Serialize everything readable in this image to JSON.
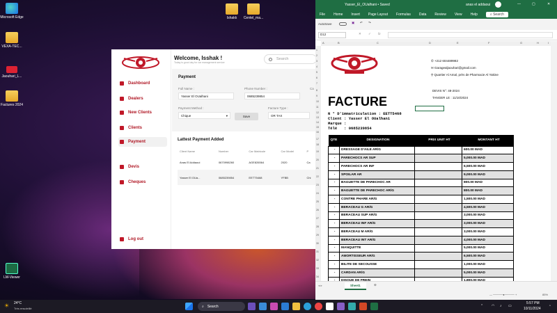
{
  "desktop": {
    "icons": [
      {
        "label": "Microsoft Edge",
        "icon": "edge-icon"
      },
      {
        "label": "VEXA-TEC...",
        "icon": "folder-icon"
      },
      {
        "label": "Jaouhari_L...",
        "icon": "logo-icon"
      },
      {
        "label": "Factures 2024",
        "icon": "folder-icon"
      },
      {
        "label": "Ishakk",
        "icon": "folder-icon"
      },
      {
        "label": "Centel_ma...",
        "icon": "folder-icon"
      },
      {
        "label": "LM-Viewer",
        "icon": "lm-icon"
      }
    ]
  },
  "app": {
    "welcome": "Welcome, Isshak !",
    "welcome_sub": "Today is good day for car management service",
    "search_placeholder": "Search",
    "nav": [
      {
        "label": "Dashboard"
      },
      {
        "label": "Dealers"
      },
      {
        "label": "New Clients"
      },
      {
        "label": "Clients"
      },
      {
        "label": "Payment"
      },
      {
        "label": "Devis"
      },
      {
        "label": "Cheques"
      },
      {
        "label": "Log out"
      }
    ],
    "payment": {
      "title": "Payment",
      "full_name_label": "Full Name :",
      "full_name": "Yasser El OUalhani",
      "phone_label": "Phone Number :",
      "phone": "0685239854",
      "method_label": "Payment Method :",
      "method": "Chique",
      "save_label": "Save",
      "type_label": "Facture Type :",
      "type": "OR TAX",
      "extra_label": "Ca"
    },
    "latest": {
      "title": "Lattest Payment Added",
      "headers": [
        "Client Name",
        "Number",
        "Car Matricule",
        "Car Model",
        "P"
      ],
      "rows": [
        [
          "Anas El Addaoui",
          "0670998260",
          "AGE826564",
          "2020",
          "Ca"
        ],
        [
          "Yasser El OUa...",
          "0685239854",
          "EETT5468",
          "YFBB",
          "Chi"
        ]
      ]
    }
  },
  "excel": {
    "title": "Yasser_El_OUalhani • Saved",
    "user": "anas el addaoui",
    "menu": [
      "File",
      "Home",
      "Insert",
      "Page Layout",
      "Formulas",
      "Data",
      "Review",
      "View",
      "Help"
    ],
    "search": "Search",
    "autosave": "AutoSave",
    "cell_ref": "D12",
    "columns": [
      "A",
      "B",
      "C",
      "D",
      "E",
      "F",
      "G",
      "H",
      "I"
    ],
    "rows": [
      "1",
      "2",
      "3",
      "4",
      "5",
      "6",
      "7",
      "8",
      "9",
      "10",
      "11",
      "12",
      "13",
      "14",
      "15",
      "16",
      "17",
      "18",
      "19",
      "20",
      "21",
      "22",
      "23",
      "24",
      "25",
      "26",
      "27",
      "28",
      "29",
      "30",
      "31",
      "32",
      "33",
      "34"
    ],
    "sheet_tab": "Sheet1",
    "zoom": "85%",
    "invoice": {
      "phone": "+212 604489982",
      "email": "Garagealjaouhari@gmail.com",
      "address": "Quartier Al Amal, près de Pharmacie Al Yakine",
      "devis": "DEVIS N°: 48-2024",
      "date": "TANGER LE : 11/10/2024",
      "title": "FACTURE",
      "line1": "N ° D'immatriculation : EETT5468",
      "line2": "Client : Yasser El OUalhani",
      "line3": "Marque :",
      "line4": "Télé   : 0685239854",
      "headers": [
        "QTE",
        "DESIGNATION",
        "PRIX UNIT HT",
        "MONTANT HT"
      ],
      "items": [
        [
          "-",
          "DRESSAGE D'AILE AR/G",
          "",
          "600.00 MAD"
        ],
        [
          "-",
          "PARECHOCS AR SUP",
          "",
          "5,000.00 MAD"
        ],
        [
          "-",
          "PARECHOCS AR INF",
          "",
          "6,500.00 MAD"
        ],
        [
          "-",
          "SPOILAR AR",
          "",
          "9,000.00 MAD"
        ],
        [
          "-",
          "BAGUETTE DE PARECHOC AR",
          "",
          "800.00 MAD"
        ],
        [
          "-",
          "BAGUETTE DE PARECHOC AR/G",
          "",
          "800.00 MAD"
        ],
        [
          "-",
          "CONTRE PHARE AR/G",
          "",
          "1,500.00 MAD"
        ],
        [
          "-",
          "BERACEAU G AR/G",
          "",
          "4,500.00 MAD"
        ],
        [
          "-",
          "BERACEAU SUP AR/G",
          "",
          "3,000.00 MAD"
        ],
        [
          "-",
          "BERACEAU INF AR/G",
          "",
          "3,000.00 MAD"
        ],
        [
          "-",
          "BERACEAU M AR/G",
          "",
          "3,000.00 MAD"
        ],
        [
          "-",
          "BERACEAU INT AR/G",
          "",
          "4,000.00 MAD"
        ],
        [
          "-",
          "MANQUITTE",
          "",
          "5,000.00 MAD"
        ],
        [
          "-",
          "AMORTISSEUR AR/G",
          "",
          "6,500.00 MAD"
        ],
        [
          "-",
          "BILITE DE SECOUSSE",
          "",
          "1,000.00 MAD"
        ],
        [
          "-",
          "CARDAN AR/G",
          "",
          "5,000.00 MAD"
        ],
        [
          "-",
          "DISQUE DE FREIN",
          "",
          "1,800.00 MAD"
        ]
      ]
    }
  },
  "taskbar": {
    "weather_temp": "24°C",
    "weather_desc": "Très ensoleillé",
    "search": "Search",
    "time": "5:57 PM",
    "date": "10/11/2024"
  }
}
